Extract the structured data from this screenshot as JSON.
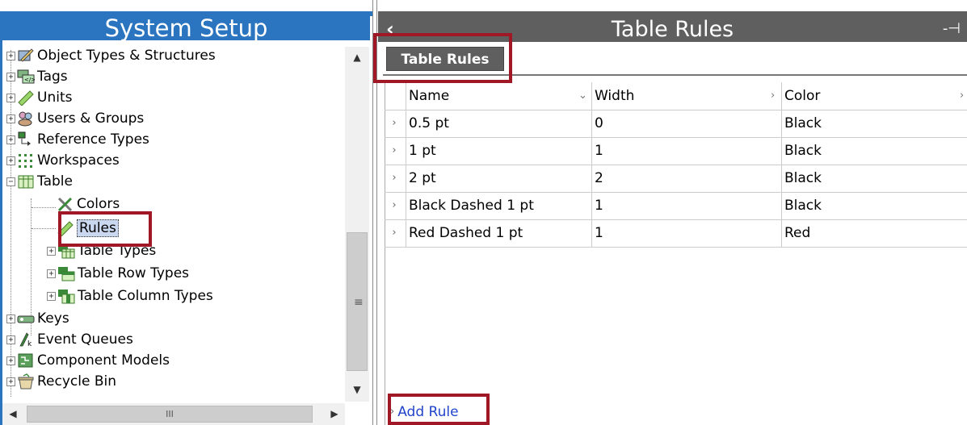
{
  "left_panel": {
    "title": "System Setup",
    "tree": [
      {
        "label": "Object Types & Structures",
        "icon": "object-types-icon",
        "expander": "+"
      },
      {
        "label": "Tags",
        "icon": "tags-icon",
        "expander": "+"
      },
      {
        "label": "Units",
        "icon": "units-ruler-icon",
        "expander": "+"
      },
      {
        "label": "Users & Groups",
        "icon": "users-groups-icon",
        "expander": "+"
      },
      {
        "label": "Reference Types",
        "icon": "reference-types-icon",
        "expander": "+"
      },
      {
        "label": "Workspaces",
        "icon": "workspaces-icon",
        "expander": "+"
      },
      {
        "label": "Table",
        "icon": "table-icon",
        "expander": "−"
      },
      {
        "label": "Colors",
        "icon": "colors-icon"
      },
      {
        "label": "Rules",
        "icon": "rules-ruler-icon",
        "selected": true
      },
      {
        "label": "Table Types",
        "icon": "table-types-icon",
        "expander": "+"
      },
      {
        "label": "Table Row Types",
        "icon": "table-row-types-icon",
        "expander": "+"
      },
      {
        "label": "Table Column Types",
        "icon": "table-column-types-icon",
        "expander": "+"
      },
      {
        "label": "Keys",
        "icon": "keys-icon",
        "expander": "+"
      },
      {
        "label": "Event Queues",
        "icon": "event-queues-icon",
        "expander": "+"
      },
      {
        "label": "Component Models",
        "icon": "component-models-icon",
        "expander": "+"
      },
      {
        "label": "Recycle Bin",
        "icon": "recycle-bin-icon",
        "expander": "+"
      }
    ],
    "scroll_grip": "≡",
    "hscroll_grip": "III"
  },
  "right_panel": {
    "title": "Table Rules",
    "back_glyph": "‹",
    "pin_glyph": "-⊣",
    "tab_label": "Table Rules",
    "columns": [
      {
        "label": "Name",
        "sort": "⌄"
      },
      {
        "label": "Width",
        "sort": "›"
      },
      {
        "label": "Color",
        "sort": "›"
      }
    ],
    "rows": [
      {
        "name": "0.5 pt",
        "width": "0",
        "color": "Black"
      },
      {
        "name": "1 pt",
        "width": "1",
        "color": "Black"
      },
      {
        "name": "2 pt",
        "width": "2",
        "color": "Black"
      },
      {
        "name": "Black Dashed 1 pt",
        "width": "1",
        "color": "Black"
      },
      {
        "name": "Red Dashed 1 pt",
        "width": "1",
        "color": "Red"
      }
    ],
    "row_marker": "›",
    "add_rule_label": "Add Rule"
  },
  "colors": {
    "left_header": "#2b74bf",
    "right_header": "#5f5f5f",
    "highlight_box": "#a01826",
    "link": "#2244cc"
  }
}
